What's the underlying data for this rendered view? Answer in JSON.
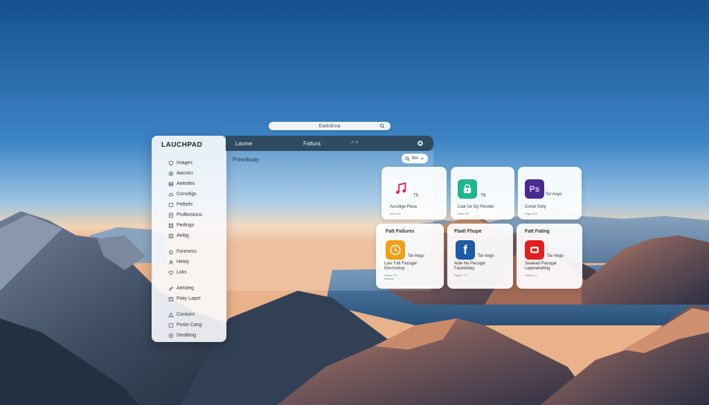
{
  "search": {
    "placeholder": "Eadcitinra"
  },
  "sidebar": {
    "title": "LAUCHPAD",
    "groups": [
      [
        {
          "label": "Images",
          "icon": "shield-icon"
        },
        {
          "label": "Awcsicr",
          "icon": "target-icon"
        },
        {
          "label": "Aeitvites",
          "icon": "stack-icon"
        },
        {
          "label": "Convitigs",
          "icon": "cloud-icon"
        },
        {
          "label": "Fetbets",
          "icon": "square-icon"
        },
        {
          "label": "Profkesions",
          "icon": "document-icon"
        },
        {
          "label": "Pedings",
          "icon": "frame-icon"
        },
        {
          "label": "Aeibg",
          "icon": "grid-icon"
        }
      ],
      [
        {
          "label": "Fonmess",
          "icon": "home-icon"
        },
        {
          "label": "Hetdy",
          "icon": "person-icon"
        },
        {
          "label": "Loks",
          "icon": "heart-icon"
        }
      ],
      [
        {
          "label": "Aelsiteg",
          "icon": "pen-icon"
        },
        {
          "label": "Fetiy Lapet",
          "icon": "box-icon"
        }
      ],
      [
        {
          "label": "Contoirs",
          "icon": "triangle-icon"
        },
        {
          "label": "Poste Cang",
          "icon": "square-icon"
        },
        {
          "label": "Deotbing",
          "icon": "compass-icon"
        }
      ]
    ]
  },
  "titlebar": {
    "left": "Laome",
    "center": "Faltura",
    "right": "↗↗"
  },
  "content": {
    "section": "Presnbuay",
    "filter": "Bel"
  },
  "cards_row1": [
    {
      "icon": "music-icon",
      "color": "#ffffff",
      "badge": "T5",
      "name": "Aucolige Pisce",
      "sub": "Bora 411"
    },
    {
      "icon": "lock-icon",
      "color": "#1fb58f",
      "badge": "TB",
      "name": "Loat Ue Oy Pecolet",
      "sub": "Naus 411"
    },
    {
      "icon": "photoshop-icon",
      "color": "#4a2b8f",
      "badge": "Tor Aoyo",
      "name": "Conat Soiiy",
      "sub": "Pags 44 0"
    }
  ],
  "cards_row2": [
    {
      "icon": "clock-icon",
      "color": "#f0a012",
      "head": "Fatt Failures",
      "badge": "Tar Aego",
      "name": "Lasr Fatt Facogal\nElectnottoy",
      "sub": "Papss 172\nRmecel"
    },
    {
      "icon": "facebook-icon",
      "color": "#1f5aa8",
      "head": "Fbatl Fhupe",
      "badge": "Tar Aego",
      "name": "Aide He Pacogal\nFacelotday",
      "sub": "Pags 1 7 0"
    },
    {
      "icon": "video-icon",
      "color": "#e02020",
      "head": "Fatt Fating",
      "badge": "Tar Aego",
      "name": "Seaelad Pacogal\nLepenetatting",
      "sub": "Panss 4.7"
    }
  ]
}
